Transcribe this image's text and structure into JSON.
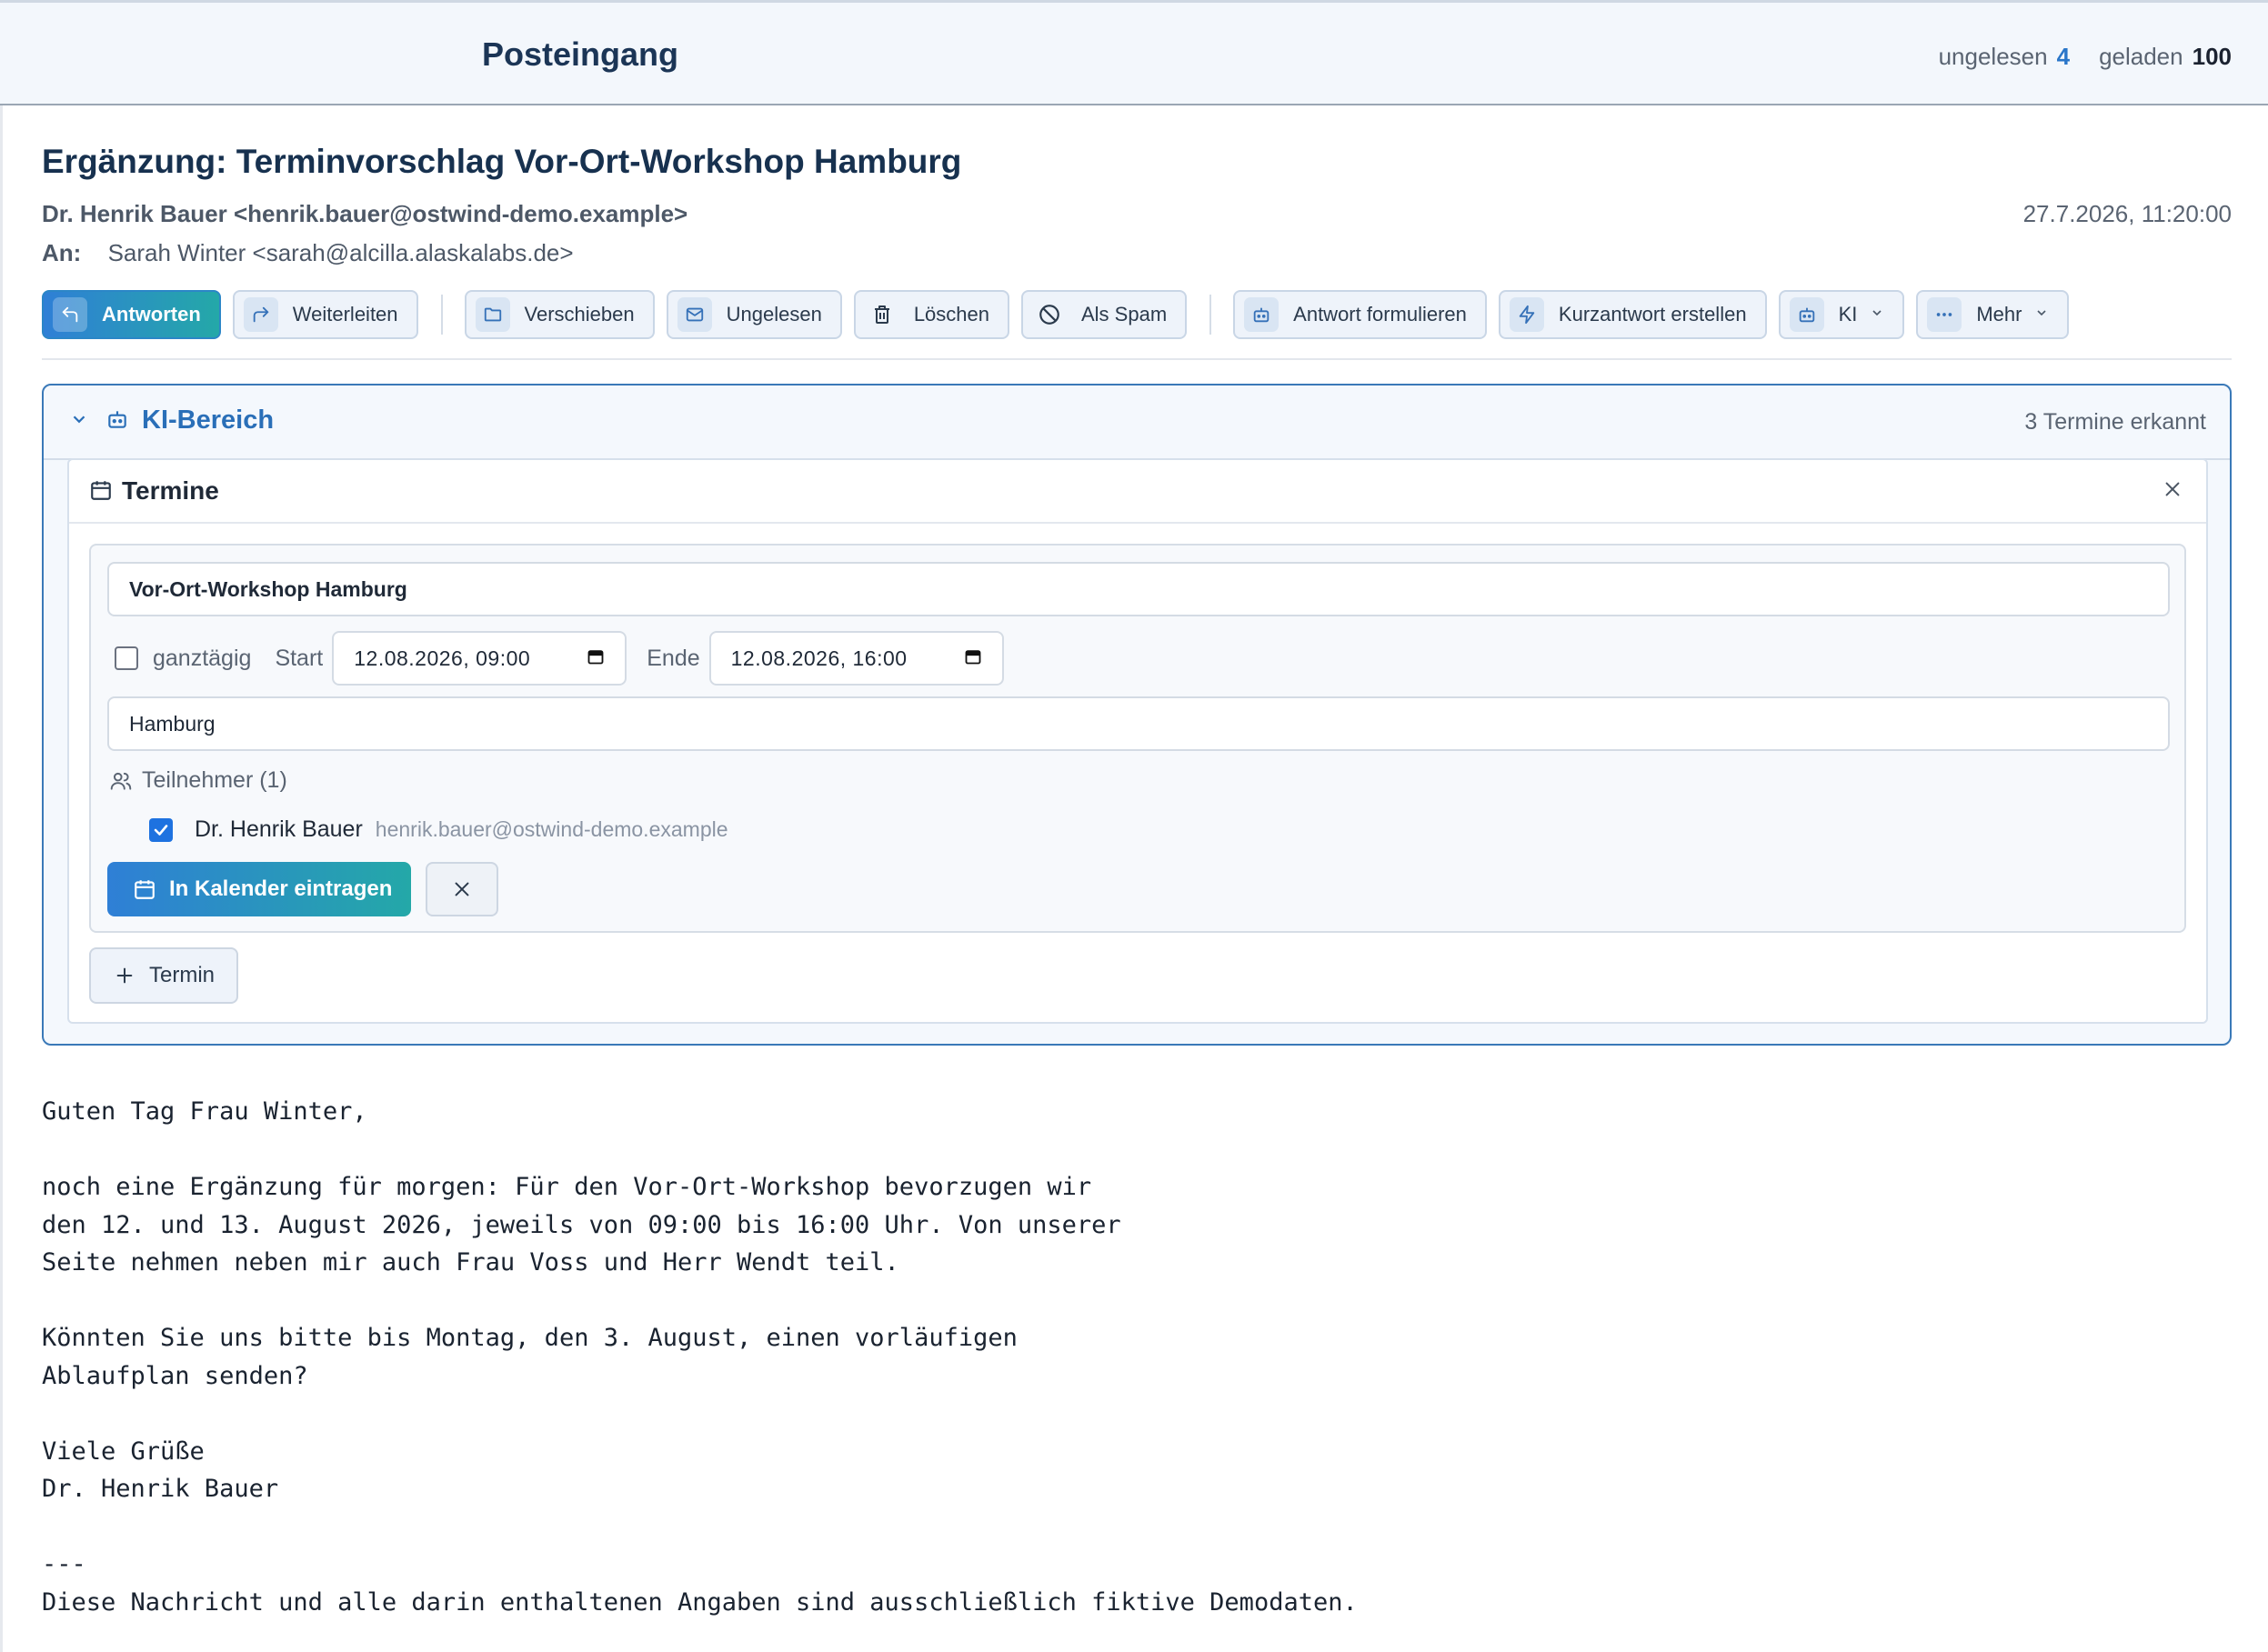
{
  "header": {
    "title": "Posteingang",
    "unread_label": "ungelesen",
    "unread_count": "4",
    "loaded_label": "geladen",
    "loaded_count": "100"
  },
  "email": {
    "subject": "Ergänzung: Terminvorschlag Vor-Ort-Workshop Hamburg",
    "from": "Dr. Henrik Bauer <henrik.bauer@ostwind-demo.example>",
    "date": "27.7.2026, 11:20:00",
    "to_label": "An:",
    "to": "Sarah Winter <sarah@alcilla.alaskalabs.de>"
  },
  "toolbar": {
    "reply": "Antworten",
    "forward": "Weiterleiten",
    "move": "Verschieben",
    "unread": "Ungelesen",
    "delete": "Löschen",
    "spam": "Als Spam",
    "draft_reply": "Antwort formulieren",
    "short_reply": "Kurzantwort erstellen",
    "ki": "KI",
    "more": "Mehr"
  },
  "ki_panel": {
    "title": "KI-Bereich",
    "count_text": "3 Termine erkannt",
    "termine_title": "Termine",
    "event": {
      "title": "Vor-Ort-Workshop Hamburg",
      "allday_label": "ganztägig",
      "start_label": "Start",
      "start_value": "12.08.2026, 09:00",
      "end_label": "Ende",
      "end_value": "12.08.2026, 16:00",
      "location": "Hamburg",
      "participants_label": "Teilnehmer (1)",
      "participant_name": "Dr. Henrik Bauer",
      "participant_email": "henrik.bauer@ostwind-demo.example",
      "add_to_calendar": "In Kalender eintragen"
    },
    "add_event": "Termin"
  },
  "body": "Guten Tag Frau Winter,\n\nnoch eine Ergänzung für morgen: Für den Vor-Ort-Workshop bevorzugen wir\nden 12. und 13. August 2026, jeweils von 09:00 bis 16:00 Uhr. Von unserer\nSeite nehmen neben mir auch Frau Voss und Herr Wendt teil.\n\nKönnten Sie uns bitte bis Montag, den 3. August, einen vorläufigen\nAblaufplan senden?\n\nViele Grüße\nDr. Henrik Bauer\n\n---\nDiese Nachricht und alle darin enthaltenen Angaben sind ausschließlich fiktive Demodaten."
}
